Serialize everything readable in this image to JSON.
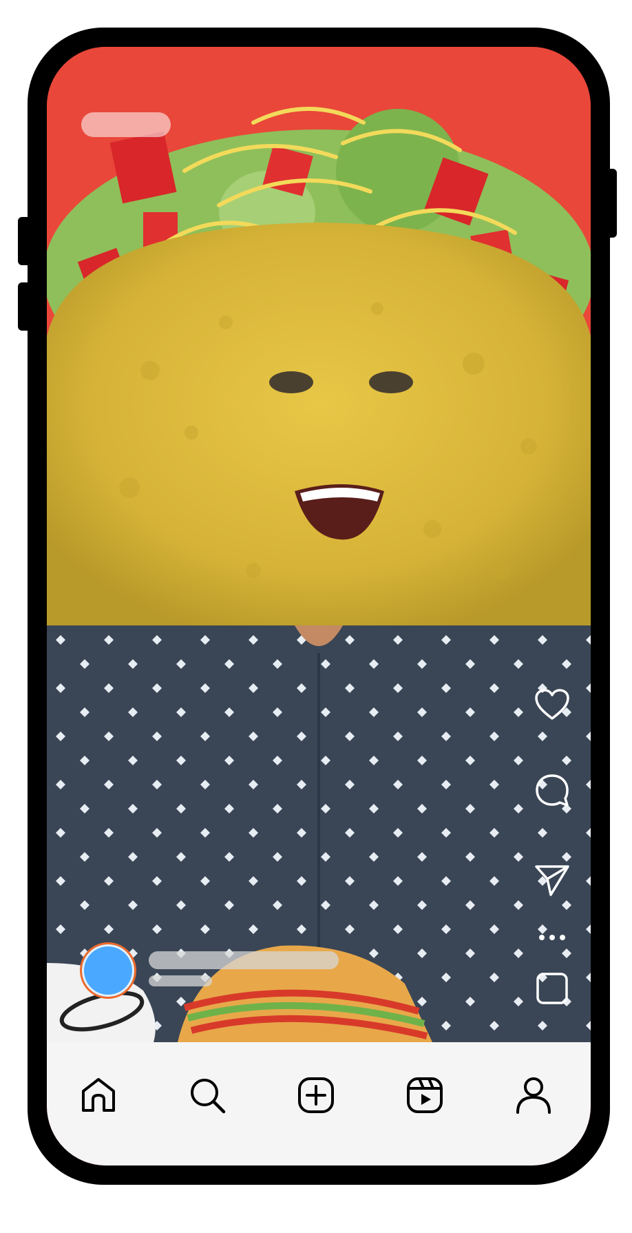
{
  "post": {
    "image": "taco-face-person-video",
    "caption": "",
    "author": ""
  },
  "actions": [
    {
      "name": "like",
      "icon": "heart-icon"
    },
    {
      "name": "comment",
      "icon": "comment-icon"
    },
    {
      "name": "share",
      "icon": "send-icon"
    },
    {
      "name": "more",
      "icon": "more-icon"
    },
    {
      "name": "audio",
      "icon": "audio-thumbnail-icon"
    }
  ],
  "nav": [
    {
      "name": "home",
      "icon": "home-icon"
    },
    {
      "name": "search",
      "icon": "search-icon"
    },
    {
      "name": "create",
      "icon": "plus-square-icon"
    },
    {
      "name": "reels",
      "icon": "reels-icon"
    },
    {
      "name": "profile",
      "icon": "profile-icon"
    }
  ],
  "colors": {
    "background": "#e9473a",
    "avatar": "#4aa8ff",
    "avatar_ring": "#f06a2b",
    "tabbar": "#f5f5f5"
  }
}
